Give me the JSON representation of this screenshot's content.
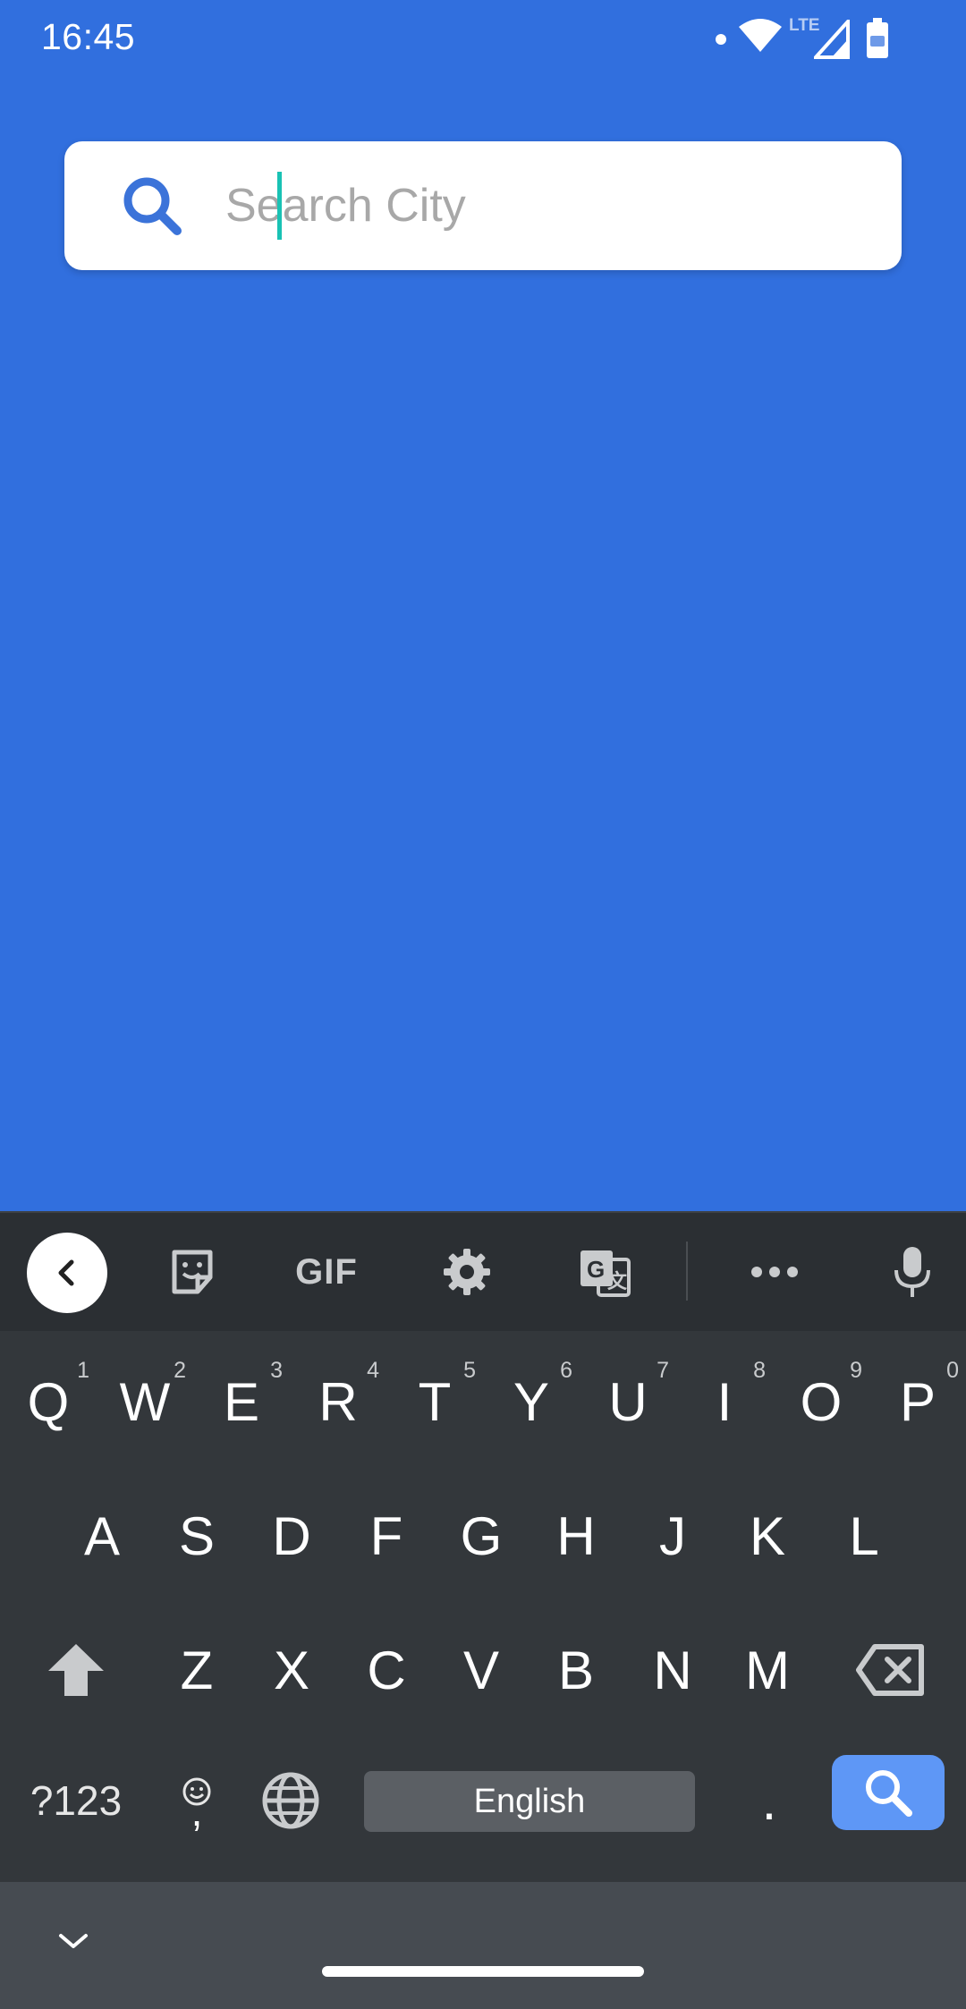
{
  "status_bar": {
    "time": "16:45",
    "network_label": "LTE",
    "icons": [
      "notification-dot-icon",
      "wifi-icon",
      "signal-icon",
      "battery-icon"
    ]
  },
  "search": {
    "placeholder": "Search City",
    "value": ""
  },
  "keyboard": {
    "toolbar": [
      "back-icon",
      "sticker-icon",
      "gif-icon",
      "gear-icon",
      "translate-icon",
      "more-icon",
      "microphone-icon"
    ],
    "gif_label": "GIF",
    "row1": [
      {
        "key": "Q",
        "hint": "1"
      },
      {
        "key": "W",
        "hint": "2"
      },
      {
        "key": "E",
        "hint": "3"
      },
      {
        "key": "R",
        "hint": "4"
      },
      {
        "key": "T",
        "hint": "5"
      },
      {
        "key": "Y",
        "hint": "6"
      },
      {
        "key": "U",
        "hint": "7"
      },
      {
        "key": "I",
        "hint": "8"
      },
      {
        "key": "O",
        "hint": "9"
      },
      {
        "key": "P",
        "hint": "0"
      }
    ],
    "row2": [
      "A",
      "S",
      "D",
      "F",
      "G",
      "H",
      "J",
      "K",
      "L"
    ],
    "row3": [
      "Z",
      "X",
      "C",
      "V",
      "B",
      "N",
      "M"
    ],
    "symbols_label": "?123",
    "comma_label": ",",
    "space_label": "English",
    "period_label": "."
  },
  "colors": {
    "background": "#316fde",
    "search_icon": "#3b73d9",
    "cursor": "#19c2b4",
    "keyboard_bg": "#33373b",
    "enter_key": "#5e97f6"
  }
}
